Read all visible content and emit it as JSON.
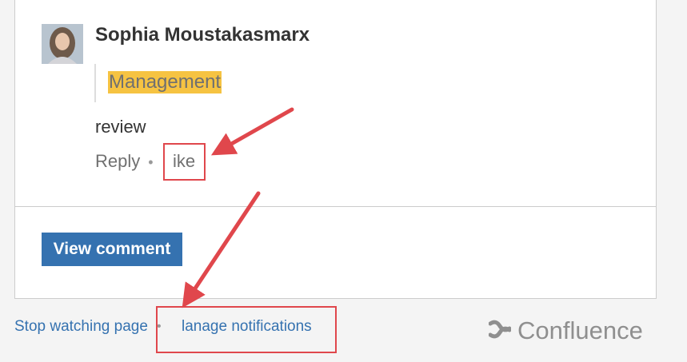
{
  "comment": {
    "author": "Sophia Moustakasmarx",
    "quoted_text": "Management",
    "body": "review",
    "reply_label": "Reply",
    "separator": "•",
    "like_label": "ike"
  },
  "view_comment_label": "View comment",
  "footer": {
    "stop_watching_label": "Stop watching page",
    "separator": "•",
    "manage_notifications_label": "lanage notifications",
    "brand_name": "Confluence"
  },
  "colors": {
    "link": "#3572b0",
    "button": "#3572b0",
    "highlight": "#f6c342",
    "annotation": "#e0474c",
    "brand": "#8f8f8f"
  },
  "icons": {
    "avatar": "user-avatar",
    "brand_logo": "confluence-logo-icon"
  }
}
